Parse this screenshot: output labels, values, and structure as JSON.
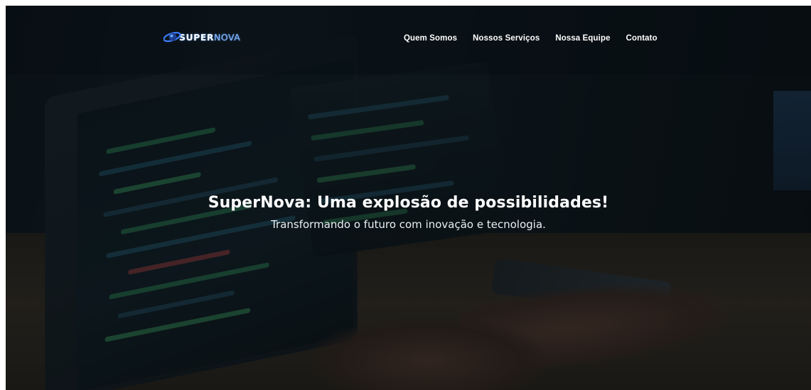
{
  "brand": {
    "logo_prefix": "SUPER",
    "logo_suffix": "NOVA",
    "logo_icon": "planet-orbit-icon",
    "accent": "#4a8cff"
  },
  "nav": {
    "items": [
      {
        "label": "Quem Somos"
      },
      {
        "label": "Nossos Serviços"
      },
      {
        "label": "Nossa Equipe"
      },
      {
        "label": "Contato"
      }
    ]
  },
  "hero": {
    "title": "SuperNova: Uma explosão de possibilidades!",
    "subtitle": "Transformando o futuro com inovação e tecnologia."
  }
}
